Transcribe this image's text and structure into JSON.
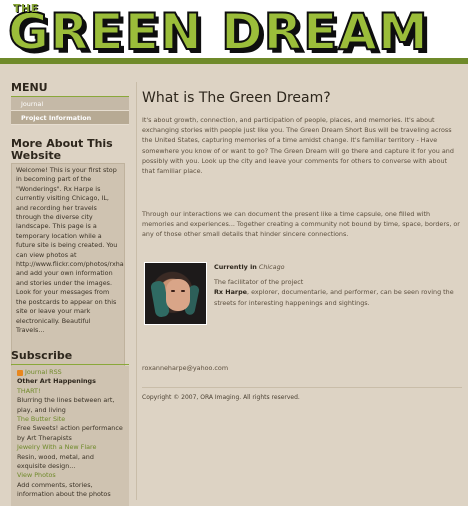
{
  "header": {
    "logo_small": "THE",
    "logo_text": "GREEN DREAM"
  },
  "sidebar": {
    "menu_title": "MENU",
    "menu_items": [
      {
        "label": "Journal"
      },
      {
        "label": "Project Information"
      }
    ],
    "about_title": "More About This Website",
    "about_text": "Welcome! This is your first stop in becoming part of the \"Wonderings\". Rx Harpe is currently visiting Chicago, IL, and recording her travels through the diverse city landscape. This page is a temporary location while a future site is being created. You can view photos at http://www.flickr.com/photos/rxha and add your own information and stories under the images. Look for your messages from the postcards to appear on this site or leave your mark electronically. Beautiful Travels...",
    "subscribe_title": "Subscribe",
    "subscribe": {
      "rss_label": "Journal RSS",
      "heading": "Other Art Happenings",
      "items": [
        {
          "link": "THART!",
          "desc": "Blurring the lines between art, play, and living"
        },
        {
          "link": "The Butter Site",
          "desc": "Free Sweets! action performance by Art Therapists"
        },
        {
          "link": "Jewelry With a New Flare",
          "desc": "Resin, wood, metal, and exquisite design..."
        },
        {
          "link": "View Photos",
          "desc": "Add comments, stories, information about the photos"
        }
      ]
    }
  },
  "main": {
    "title": "What is The Green Dream?",
    "paragraph1": "It's about growth, connection, and participation of people, places, and memories. It's about exchanging stories with people just like you. The Green Dream Short Bus will be traveling across the United States, capturing memories of a time amidst change. It's familiar territory - Have somewhere you know of or want to go? The Green Dream will go there and capture it for you and possibly with you. Look up the city and leave your comments for others to converse with about that familiar place.",
    "paragraph2": "Through our interactions we can document the present like a time capsule, one filled with memories and experiences... Together creating a community not bound by time, space, borders, or any of those other small details that hinder sincere connections.",
    "profile": {
      "currently_label": "Currently in",
      "location": "Chicago",
      "line1": "The facilitator of the project",
      "name": "Rx Harpe",
      "bio": ", explorer, documentarie, and performer, can be seen roving the streets for interesting happenings and sightings."
    },
    "email": "roxanneharpe@yahoo.com",
    "copyright": "Copyright © 2007, ORA Imaging. All rights reserved."
  }
}
